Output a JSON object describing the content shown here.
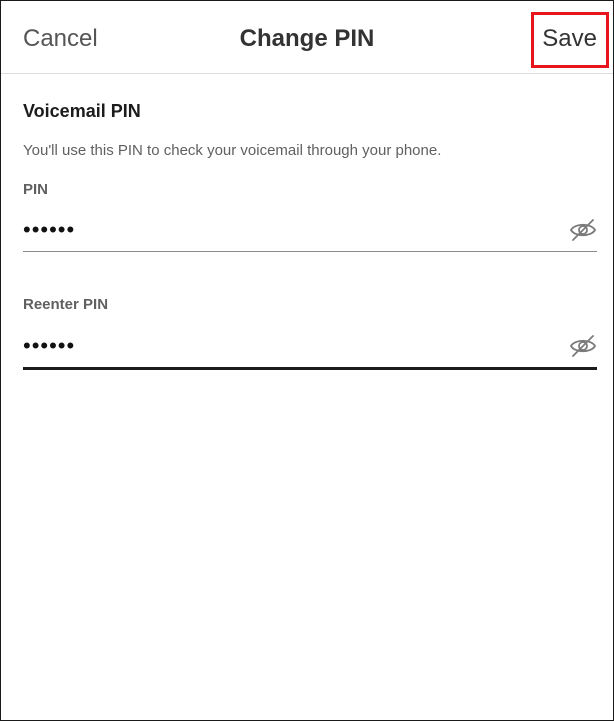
{
  "navbar": {
    "cancel_label": "Cancel",
    "title": "Change PIN",
    "save_label": "Save"
  },
  "section": {
    "heading": "Voicemail PIN",
    "description": "You'll use this PIN to check your voicemail through your phone."
  },
  "fields": {
    "pin": {
      "label": "PIN",
      "value": "••••••",
      "toggle_icon": "eye-slash-icon"
    },
    "reenter": {
      "label": "Reenter PIN",
      "value": "••••••",
      "toggle_icon": "eye-slash-icon"
    }
  },
  "colors": {
    "highlight": "#e8141c",
    "text_primary": "#1d1c1d",
    "text_secondary": "#616061",
    "divider": "#dcdcdc"
  }
}
